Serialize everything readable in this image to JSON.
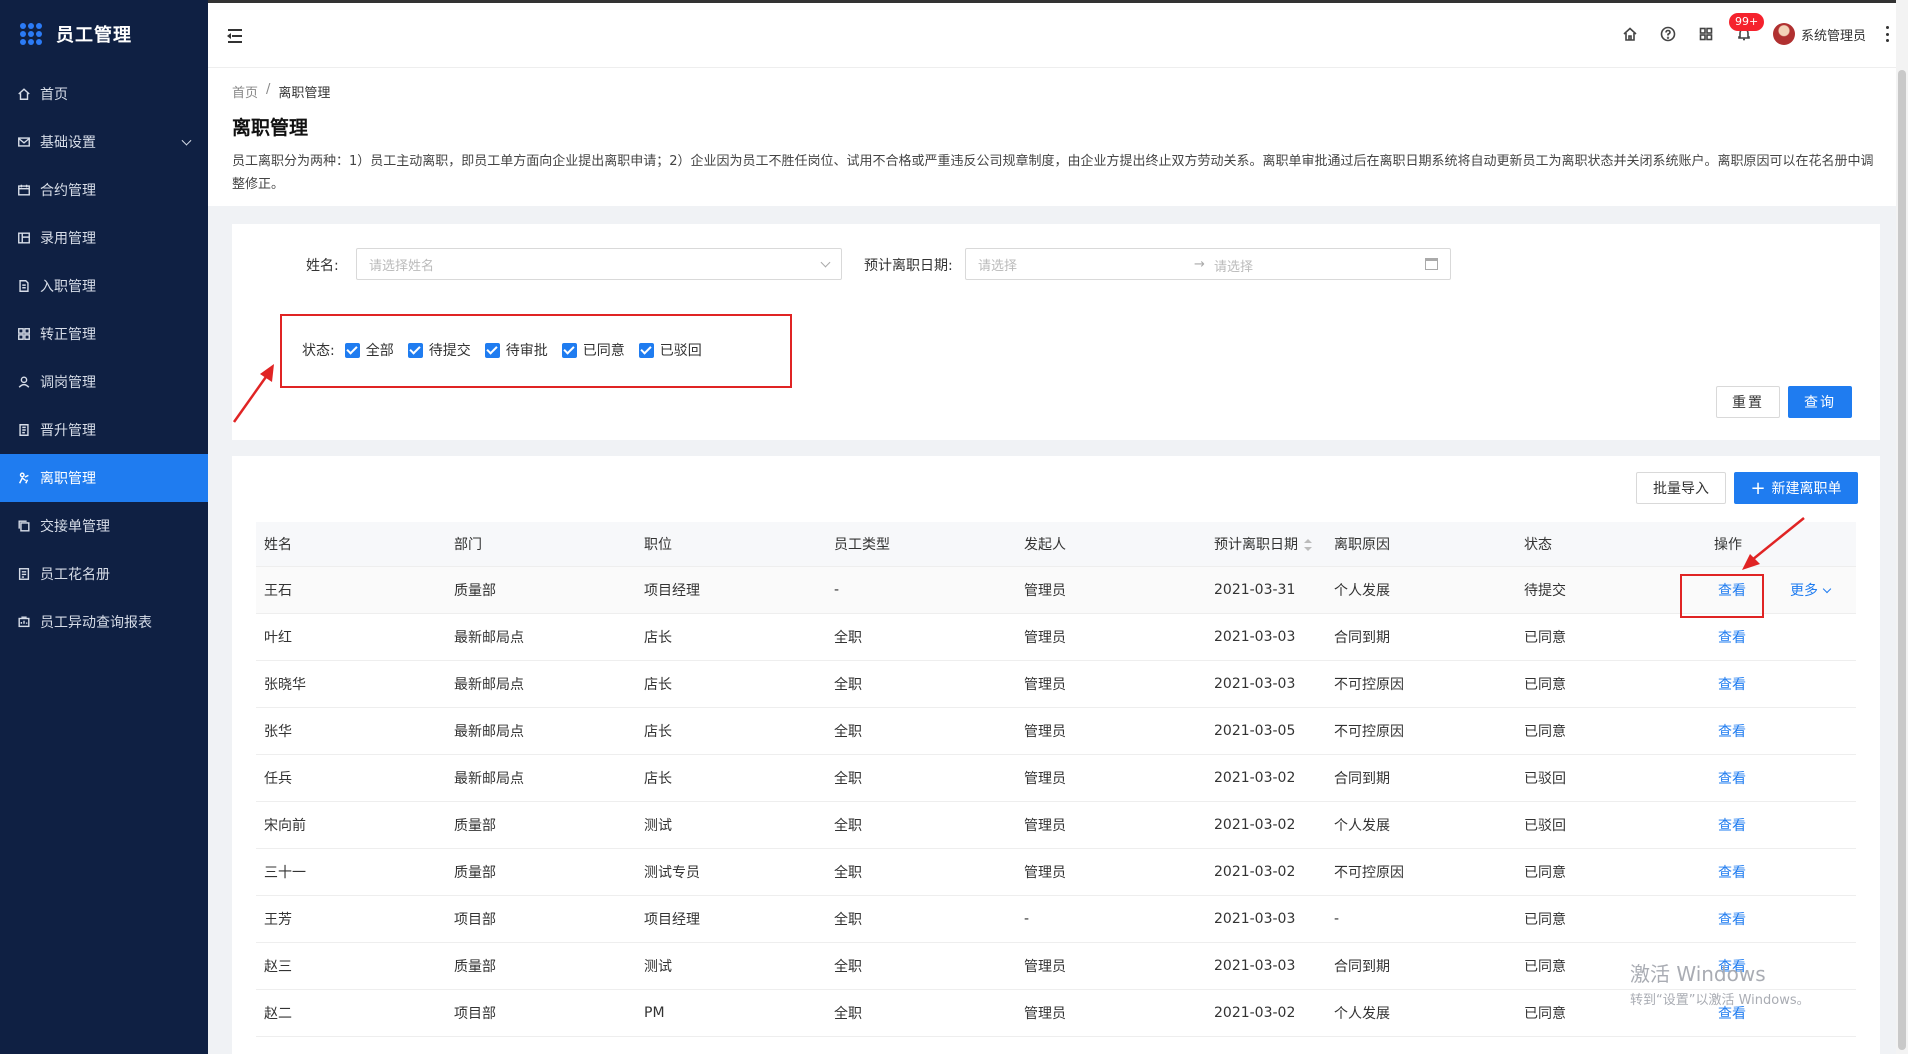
{
  "app": {
    "title": "员工管理"
  },
  "sidebar": {
    "items": [
      {
        "label": "首页",
        "icon": "home-icon"
      },
      {
        "label": "基础设置",
        "icon": "mail-icon"
      },
      {
        "label": "合约管理",
        "icon": "calendar-icon"
      },
      {
        "label": "录用管理",
        "icon": "board-icon"
      },
      {
        "label": "入职管理",
        "icon": "document-icon"
      },
      {
        "label": "转正管理",
        "icon": "grid-icon"
      },
      {
        "label": "调岗管理",
        "icon": "user-icon"
      },
      {
        "label": "晋升管理",
        "icon": "file-icon"
      },
      {
        "label": "离职管理",
        "icon": "exit-icon"
      },
      {
        "label": "交接单管理",
        "icon": "copy-icon"
      },
      {
        "label": "员工花名册",
        "icon": "roster-icon"
      },
      {
        "label": "员工异动查询报表",
        "icon": "report-icon"
      }
    ],
    "active_index": 8
  },
  "header": {
    "notification_badge": "99+",
    "username": "系统管理员"
  },
  "breadcrumb": {
    "home": "首页",
    "sep": "/",
    "current": "离职管理"
  },
  "page": {
    "title": "离职管理",
    "description": "员工离职分为两种：1）员工主动离职，即员工单方面向企业提出离职申请；2）企业因为员工不胜任岗位、试用不合格或严重违反公司规章制度，由企业方提出终止双方劳动关系。离职单审批通过后在离职日期系统将自动更新员工为离职状态并关闭系统账户。离职原因可以在花名册中调整修正。"
  },
  "filter": {
    "name_label": "姓名:",
    "name_placeholder": "请选择姓名",
    "date_label": "预计离职日期:",
    "date_start_placeholder": "请选择",
    "date_arrow": "→",
    "date_end_placeholder": "请选择",
    "status_label": "状态:",
    "statuses": [
      "全部",
      "待提交",
      "待审批",
      "已同意",
      "已驳回"
    ],
    "reset_label": "重置",
    "query_label": "查询"
  },
  "toolbar": {
    "import_label": "批量导入",
    "new_label": "新建离职单"
  },
  "table": {
    "columns": [
      "姓名",
      "部门",
      "职位",
      "员工类型",
      "发起人",
      "预计离职日期",
      "离职原因",
      "状态",
      "操作"
    ],
    "view_label": "查看",
    "more_label": "更多",
    "rows": [
      [
        "王石",
        "质量部",
        "项目经理",
        "-",
        "管理员",
        "2021-03-31",
        "个人发展",
        "待提交"
      ],
      [
        "叶红",
        "最新邮局点",
        "店长",
        "全职",
        "管理员",
        "2021-03-03",
        "合同到期",
        "已同意"
      ],
      [
        "张晓华",
        "最新邮局点",
        "店长",
        "全职",
        "管理员",
        "2021-03-03",
        "不可控原因",
        "已同意"
      ],
      [
        "张华",
        "最新邮局点",
        "店长",
        "全职",
        "管理员",
        "2021-03-05",
        "不可控原因",
        "已同意"
      ],
      [
        "任兵",
        "最新邮局点",
        "店长",
        "全职",
        "管理员",
        "2021-03-02",
        "合同到期",
        "已驳回"
      ],
      [
        "宋向前",
        "质量部",
        "测试",
        "全职",
        "管理员",
        "2021-03-02",
        "个人发展",
        "已驳回"
      ],
      [
        "三十一",
        "质量部",
        "测试专员",
        "全职",
        "管理员",
        "2021-03-02",
        "不可控原因",
        "已同意"
      ],
      [
        "王芳",
        "项目部",
        "项目经理",
        "全职",
        "-",
        "2021-03-03",
        "-",
        "已同意"
      ],
      [
        "赵三",
        "质量部",
        "测试",
        "全职",
        "管理员",
        "2021-03-03",
        "合同到期",
        "已同意"
      ],
      [
        "赵二",
        "项目部",
        "PM",
        "全职",
        "管理员",
        "2021-03-02",
        "个人发展",
        "已同意"
      ]
    ]
  },
  "watermark": {
    "line1": "激活 Windows",
    "line2": "转到“设置”以激活 Windows。"
  },
  "colors": {
    "sidebar_bg": "#0f2043",
    "primary": "#1f7cf0",
    "annotation": "#e02424"
  }
}
